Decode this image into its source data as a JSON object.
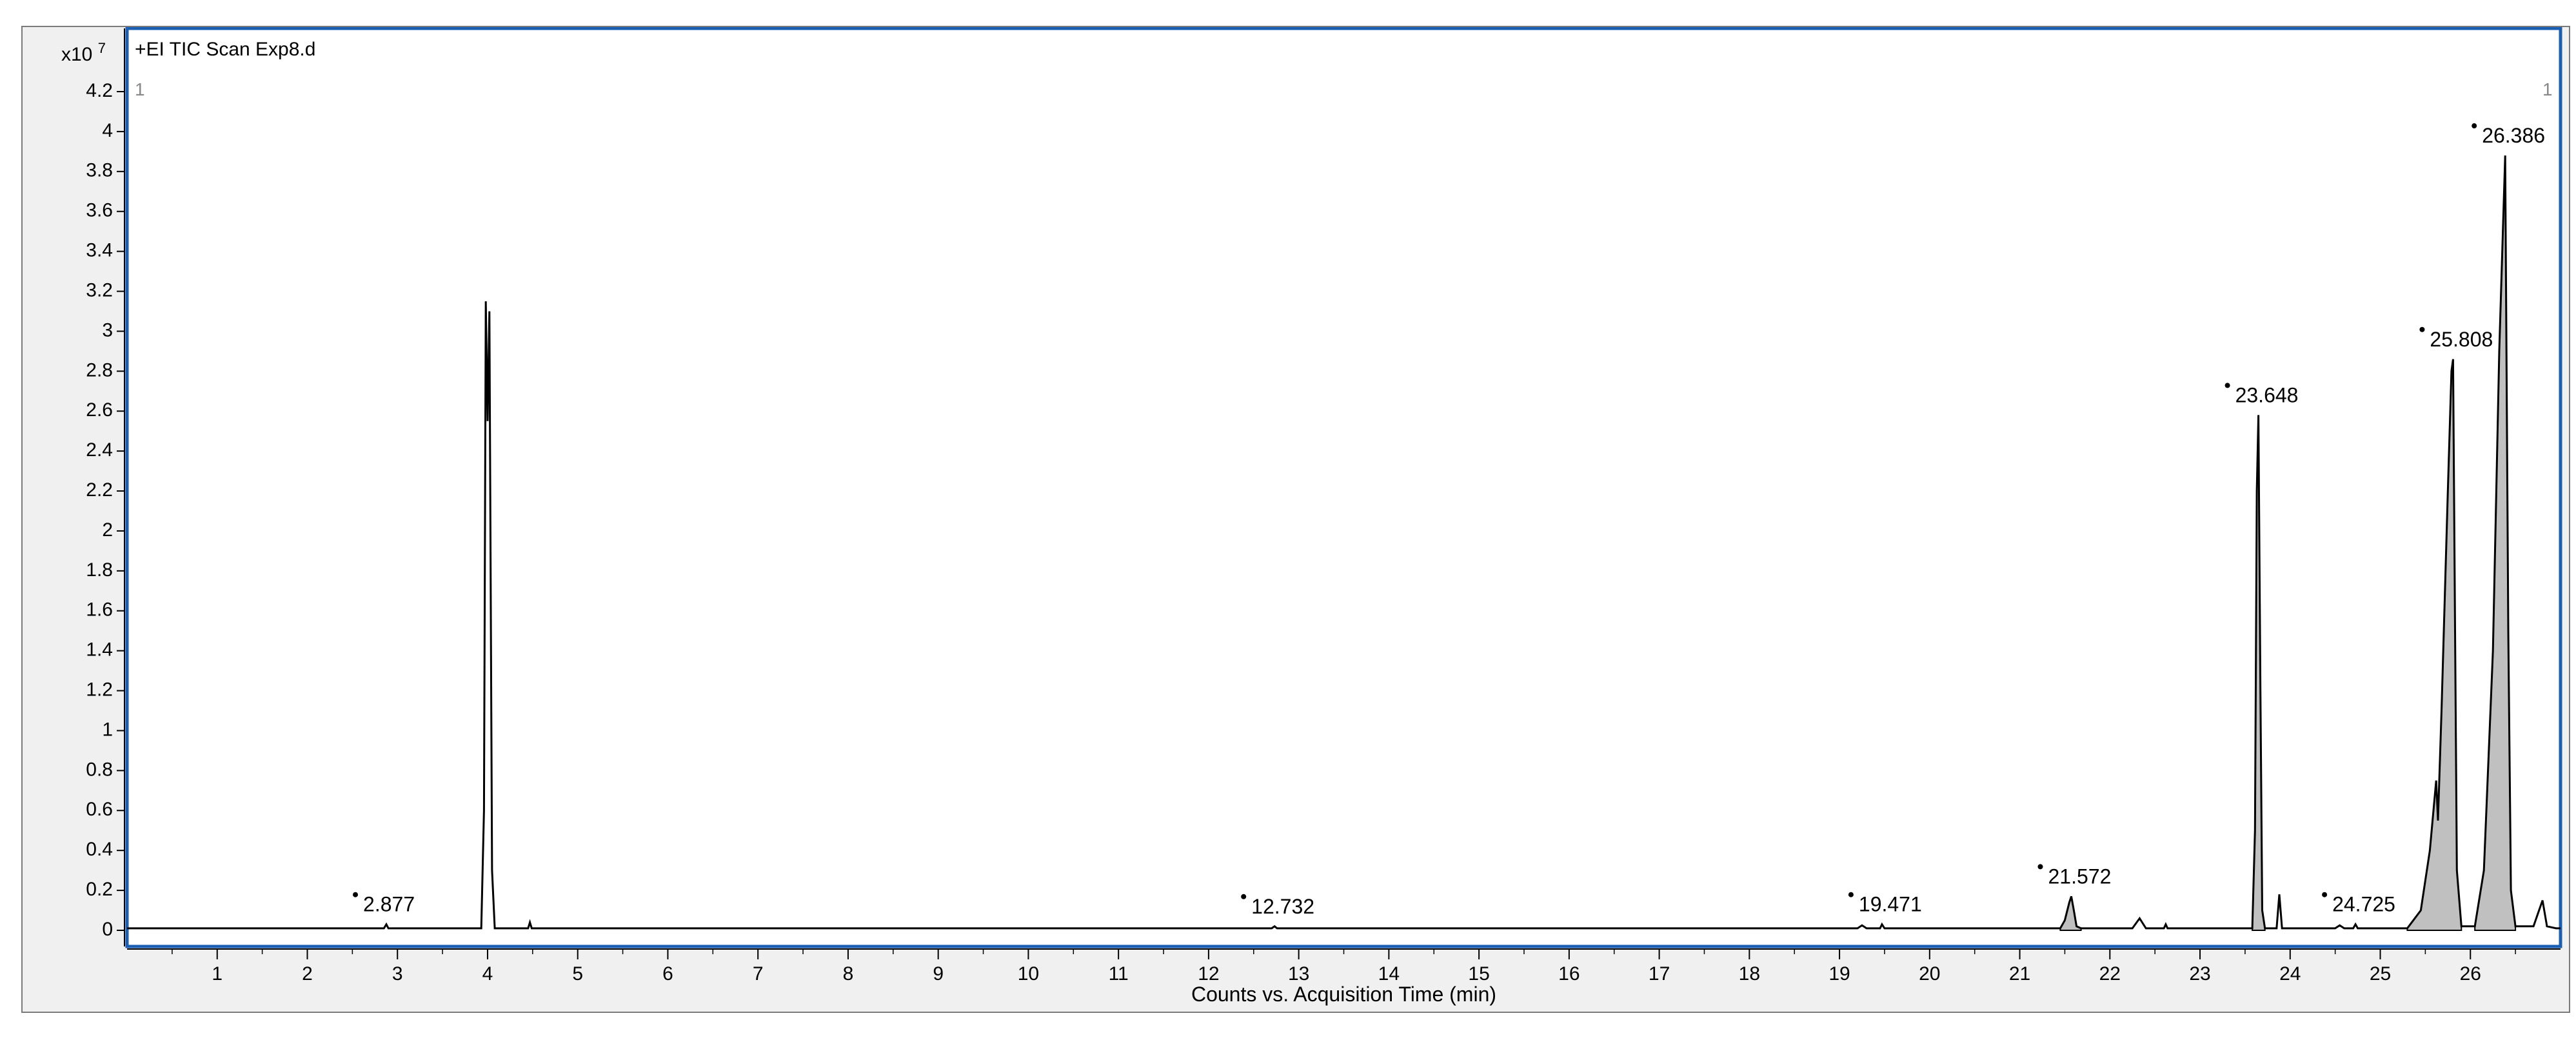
{
  "chart_data": {
    "type": "line",
    "title": "+EI TIC Scan Exp8.d",
    "xlabel": "Counts vs. Acquisition Time (min)",
    "ylabel": "",
    "y_multiplier": "x10",
    "y_multiplier_exp": "7",
    "corner_left": "1",
    "corner_right": "1",
    "xlim": [
      0,
      27.0
    ],
    "ylim": [
      0,
      4.2
    ],
    "x_ticks": [
      "1",
      "2",
      "3",
      "4",
      "5",
      "6",
      "7",
      "8",
      "9",
      "10",
      "11",
      "12",
      "13",
      "14",
      "15",
      "16",
      "17",
      "18",
      "19",
      "20",
      "21",
      "22",
      "23",
      "24",
      "25",
      "26"
    ],
    "y_ticks": [
      "0",
      "0.2",
      "0.4",
      "0.6",
      "0.8",
      "1",
      "1.2",
      "1.4",
      "1.6",
      "1.8",
      "2",
      "2.2",
      "2.4",
      "2.6",
      "2.8",
      "3",
      "3.2",
      "3.4",
      "3.6",
      "3.8",
      "4",
      "4.2"
    ],
    "grid": false,
    "series": [
      {
        "color": "#000000",
        "points": [
          [
            0,
            0.01
          ],
          [
            2.85,
            0.01
          ],
          [
            2.877,
            0.03
          ],
          [
            2.9,
            0.01
          ],
          [
            3.93,
            0.01
          ],
          [
            3.96,
            0.6
          ],
          [
            3.98,
            3.15
          ],
          [
            4.0,
            2.55
          ],
          [
            4.02,
            3.1
          ],
          [
            4.05,
            0.3
          ],
          [
            4.08,
            0.01
          ],
          [
            4.45,
            0.01
          ],
          [
            4.47,
            0.04
          ],
          [
            4.49,
            0.01
          ],
          [
            12.7,
            0.01
          ],
          [
            12.732,
            0.02
          ],
          [
            12.76,
            0.01
          ],
          [
            19.2,
            0.01
          ],
          [
            19.25,
            0.025
          ],
          [
            19.3,
            0.01
          ],
          [
            19.45,
            0.01
          ],
          [
            19.471,
            0.03
          ],
          [
            19.5,
            0.01
          ],
          [
            21.45,
            0.01
          ],
          [
            21.5,
            0.05
          ],
          [
            21.55,
            0.14
          ],
          [
            21.572,
            0.17
          ],
          [
            21.6,
            0.1
          ],
          [
            21.63,
            0.02
          ],
          [
            21.68,
            0.01
          ],
          [
            22.25,
            0.01
          ],
          [
            22.33,
            0.06
          ],
          [
            22.4,
            0.01
          ],
          [
            22.6,
            0.01
          ],
          [
            22.62,
            0.03
          ],
          [
            22.64,
            0.01
          ],
          [
            23.58,
            0.01
          ],
          [
            23.61,
            0.5
          ],
          [
            23.63,
            2.2
          ],
          [
            23.648,
            2.58
          ],
          [
            23.67,
            1.2
          ],
          [
            23.69,
            0.1
          ],
          [
            23.72,
            0.01
          ],
          [
            23.85,
            0.01
          ],
          [
            23.88,
            0.18
          ],
          [
            23.91,
            0.01
          ],
          [
            24.5,
            0.01
          ],
          [
            24.55,
            0.025
          ],
          [
            24.6,
            0.01
          ],
          [
            24.7,
            0.01
          ],
          [
            24.725,
            0.03
          ],
          [
            24.75,
            0.01
          ],
          [
            25.3,
            0.01
          ],
          [
            25.45,
            0.1
          ],
          [
            25.55,
            0.4
          ],
          [
            25.62,
            0.75
          ],
          [
            25.64,
            0.55
          ],
          [
            25.68,
            1.1
          ],
          [
            25.75,
            2.2
          ],
          [
            25.79,
            2.8
          ],
          [
            25.808,
            2.86
          ],
          [
            25.83,
            1.5
          ],
          [
            25.85,
            0.3
          ],
          [
            25.9,
            0.02
          ],
          [
            26.05,
            0.02
          ],
          [
            26.15,
            0.3
          ],
          [
            26.25,
            1.4
          ],
          [
            26.32,
            2.9
          ],
          [
            26.386,
            3.88
          ],
          [
            26.42,
            1.5
          ],
          [
            26.45,
            0.2
          ],
          [
            26.5,
            0.02
          ],
          [
            26.7,
            0.02
          ],
          [
            26.8,
            0.15
          ],
          [
            26.85,
            0.02
          ],
          [
            26.95,
            0.01
          ],
          [
            27.0,
            0.01
          ]
        ]
      }
    ],
    "peaks": [
      {
        "label": "2.877",
        "x": 2.877,
        "y": 0.03,
        "filled": false
      },
      {
        "label": "12.732",
        "x": 12.732,
        "y": 0.02,
        "filled": false
      },
      {
        "label": "19.471",
        "x": 19.471,
        "y": 0.03,
        "filled": false
      },
      {
        "label": "21.572",
        "x": 21.572,
        "y": 0.17,
        "filled": true,
        "range": [
          21.45,
          21.68
        ]
      },
      {
        "label": "23.648",
        "x": 23.648,
        "y": 2.58,
        "filled": true,
        "range": [
          23.58,
          23.72
        ]
      },
      {
        "label": "24.725",
        "x": 24.725,
        "y": 0.03,
        "filled": false
      },
      {
        "label": "25.808",
        "x": 25.808,
        "y": 2.86,
        "filled": true,
        "range": [
          25.3,
          25.9
        ]
      },
      {
        "label": "26.386",
        "x": 26.386,
        "y": 3.88,
        "filled": true,
        "range": [
          26.05,
          26.5
        ]
      }
    ],
    "colors": {
      "plot_border": "#1a5fb4",
      "trace": "#000000",
      "peak_fill": "#c0c0c0",
      "frame_bg": "#f0f0f0",
      "plot_bg": "#ffffff"
    }
  }
}
